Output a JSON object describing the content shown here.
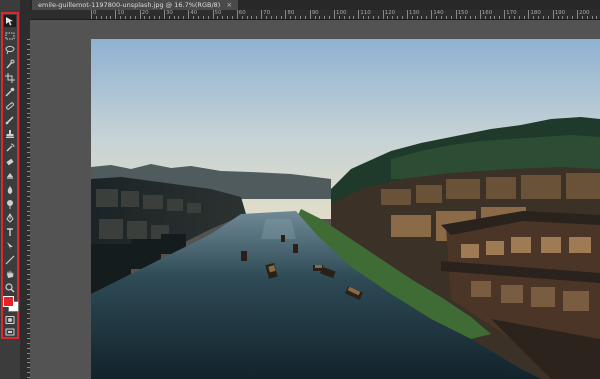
{
  "document": {
    "tab_title": "emile-guillemot-1197800-unsplash.jpg @ 16.7%(RGB/8)",
    "close_glyph": "×"
  },
  "ruler": {
    "top_labels": [
      "0",
      "10",
      "20",
      "30",
      "40",
      "50",
      "60",
      "70",
      "80",
      "90",
      "100",
      "110",
      "120",
      "130",
      "140",
      "150",
      "160",
      "170",
      "180",
      "190",
      "200",
      "210"
    ]
  },
  "tools": [
    "move-tool-icon",
    "marquee-tool-icon",
    "lasso-tool-icon",
    "quick-select-tool-icon",
    "crop-tool-icon",
    "eyedropper-tool-icon",
    "healing-brush-tool-icon",
    "brush-tool-icon",
    "clone-stamp-tool-icon",
    "history-brush-tool-icon",
    "eraser-tool-icon",
    "gradient-tool-icon",
    "blur-tool-icon",
    "dodge-tool-icon",
    "pen-tool-icon",
    "type-tool-icon",
    "path-select-tool-icon",
    "line-tool-icon",
    "hand-tool-icon",
    "zoom-tool-icon"
  ],
  "colors": {
    "foreground": "#e3222b",
    "background": "#ffffff",
    "highlight": "#e0262e"
  }
}
